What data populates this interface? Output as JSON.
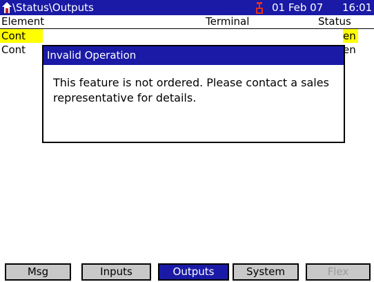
{
  "window": {
    "title_path": "\\Status\\Outputs",
    "date": "01 Feb 07",
    "time": "16:01"
  },
  "table": {
    "columns": {
      "element": "Element",
      "terminal": "Terminal",
      "status": "Status"
    },
    "rows": [
      {
        "element_visible": "Cont",
        "status_visible": "en",
        "highlighted": true
      },
      {
        "element_visible": "Cont",
        "status_visible": "en",
        "highlighted": false
      }
    ]
  },
  "dialog": {
    "title": "Invalid Operation",
    "message": "This feature is not ordered.  Please contact a sales representative for details."
  },
  "tabs": [
    {
      "label": "Msg"
    },
    {
      "label": "Inputs"
    },
    {
      "label": "Outputs",
      "active": true
    },
    {
      "label": "System"
    },
    {
      "label": "Flex",
      "disabled": true
    }
  ],
  "colors": {
    "titlebar": "#1a1aa6",
    "highlight": "#ffff00",
    "tab": "#c8c8c8",
    "alarm": "#e03020"
  },
  "icons": {
    "home": "home-icon",
    "alarm": "alarm-icon"
  }
}
